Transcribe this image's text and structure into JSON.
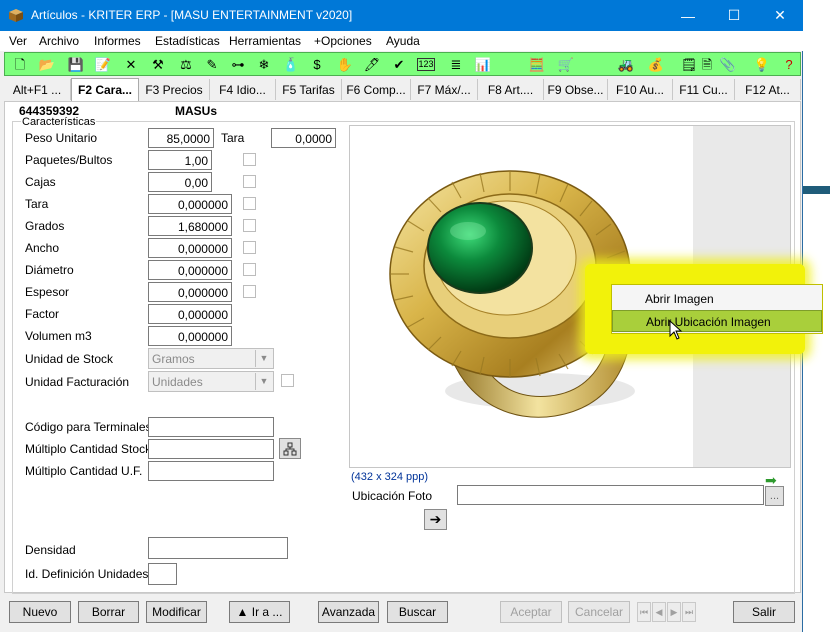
{
  "window": {
    "title": "Artículos - KRITER ERP - [MASU ENTERTAINMENT v2020]",
    "minimize": "—",
    "maximize": "☐",
    "close": "✕"
  },
  "menu": [
    "Ver",
    "Archivo",
    "Informes",
    "Estadísticas",
    "Herramientas",
    "+Opciones",
    "Ayuda"
  ],
  "toolbar_icons": [
    "new-document-icon",
    "open-folder-icon",
    "save-icon",
    "edit-icon",
    "delete-icon",
    "tool-icon",
    "scale-icon",
    "brush-icon",
    "tree-icon",
    "snowflake-icon",
    "bottle-icon",
    "dollar-icon",
    "hand-icon",
    "pen-icon",
    "check-pen-icon",
    "numbers-icon",
    "stack-icon",
    "bar-chart-icon",
    "calculator-icon",
    "cart-icon",
    "vehicle-icon",
    "money-bag-icon",
    "note-icon",
    "page-icon",
    "paperclip-icon",
    "lightbulb-icon",
    "help-icon"
  ],
  "tabs": [
    {
      "label": "Alt+F1 ...",
      "active": false
    },
    {
      "label": "F2 Cara...",
      "active": true
    },
    {
      "label": "F3 Precios",
      "active": false
    },
    {
      "label": "F4 Idio...",
      "active": false
    },
    {
      "label": "F5 Tarifas",
      "active": false
    },
    {
      "label": "F6 Comp...",
      "active": false
    },
    {
      "label": "F7 Máx/...",
      "active": false
    },
    {
      "label": "F8 Art....",
      "active": false
    },
    {
      "label": "F9 Obse...",
      "active": false
    },
    {
      "label": "F10 Au...",
      "active": false
    },
    {
      "label": "F11 Cu...",
      "active": false
    },
    {
      "label": "F12 At...",
      "active": false
    }
  ],
  "article": {
    "code": "644359392",
    "name": "MASUs"
  },
  "group_title": "Características",
  "fields": {
    "peso_unitario": {
      "label": "Peso Unitario",
      "value": "85,0000"
    },
    "tara_top": {
      "label": "Tara",
      "value": "0,0000"
    },
    "paquetes": {
      "label": "Paquetes/Bultos",
      "value": "1,00"
    },
    "cajas": {
      "label": "Cajas",
      "value": "0,00"
    },
    "tara": {
      "label": "Tara",
      "value": "0,000000"
    },
    "grados": {
      "label": "Grados",
      "value": "1,680000"
    },
    "ancho": {
      "label": "Ancho",
      "value": "0,000000"
    },
    "diametro": {
      "label": "Diámetro",
      "value": "0,000000"
    },
    "espesor": {
      "label": "Espesor",
      "value": "0,000000"
    },
    "factor": {
      "label": "Factor",
      "value": "0,000000"
    },
    "volumen": {
      "label": "Volumen m3",
      "value": "0,000000"
    },
    "unidad_stock": {
      "label": "Unidad de Stock",
      "value": "Gramos"
    },
    "unidad_facturacion": {
      "label": "Unidad Facturación",
      "value": "Unidades"
    },
    "codigo_terminales": {
      "label": "Código para Terminales",
      "value": ""
    },
    "multiplo_stock": {
      "label": "Múltiplo Cantidad Stock",
      "value": ""
    },
    "multiplo_uf": {
      "label": "Múltiplo Cantidad U.F.",
      "value": ""
    },
    "densidad": {
      "label": "Densidad",
      "value": ""
    },
    "id_definicion": {
      "label": "Id. Definición Unidades",
      "value": ""
    }
  },
  "image": {
    "size_text": "(432 x 324 ppp)",
    "location_label": "Ubicación Foto",
    "location_value": "",
    "browse_label": "..."
  },
  "context_menu": [
    {
      "label": "Abrir Imagen",
      "highlighted": false
    },
    {
      "label": "Abrir Ubicación Imagen",
      "highlighted": true
    }
  ],
  "buttons": {
    "nuevo": "Nuevo",
    "borrar": "Borrar",
    "modificar": "Modificar",
    "ir_a": "▲ Ir a ...",
    "avanzada": "Avanzada",
    "buscar": "Buscar",
    "aceptar": "Aceptar",
    "cancelar": "Cancelar",
    "salir": "Salir"
  },
  "colors": {
    "titlebar": "#0078d7",
    "toolbar": "#7dff7d",
    "highlight": "#f2f20a",
    "menu_highlight": "#a9cf3b"
  }
}
